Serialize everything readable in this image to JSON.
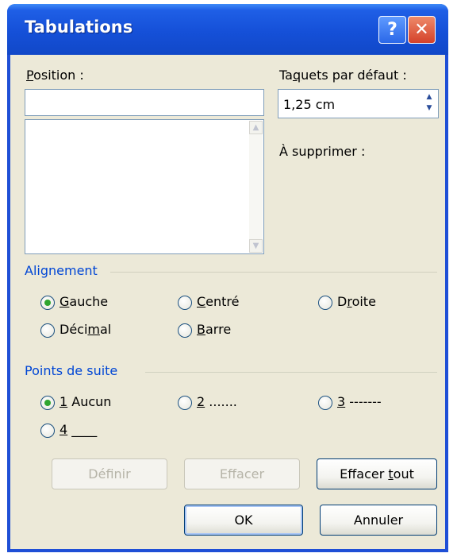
{
  "window": {
    "title": "Tabulations",
    "help_label": "?",
    "close_label": "✕"
  },
  "position": {
    "label_u": "P",
    "label_rest": "osition :",
    "value": ""
  },
  "default_stops": {
    "label_pre": "Ta",
    "label_u": "q",
    "label_rest": "uets par défaut :",
    "value": "1,25 cm"
  },
  "to_delete_label": "À supprimer :",
  "alignment": {
    "title": "Alignement",
    "options": [
      {
        "u": "G",
        "rest": "auche",
        "checked": true
      },
      {
        "u": "C",
        "rest": "entré",
        "checked": false
      },
      {
        "pre": "D",
        "u": "r",
        "rest": "oite",
        "checked": false
      },
      {
        "pre": "Déci",
        "u": "m",
        "rest": "al",
        "checked": false
      },
      {
        "u": "B",
        "rest": "arre",
        "checked": false
      }
    ]
  },
  "leaders": {
    "title": "Points de suite",
    "options": [
      {
        "u": "1",
        "rest": " Aucun",
        "checked": true
      },
      {
        "u": "2",
        "rest": " .......",
        "checked": false
      },
      {
        "u": "3",
        "rest": " -------",
        "checked": false
      },
      {
        "u": "4",
        "rest": " ____",
        "checked": false
      }
    ]
  },
  "buttons": {
    "define": "Définir",
    "clear": "Effacer",
    "clear_all_pre": "Effacer ",
    "clear_all_u": "t",
    "clear_all_rest": "out",
    "ok": "OK",
    "cancel": "Annuler"
  }
}
